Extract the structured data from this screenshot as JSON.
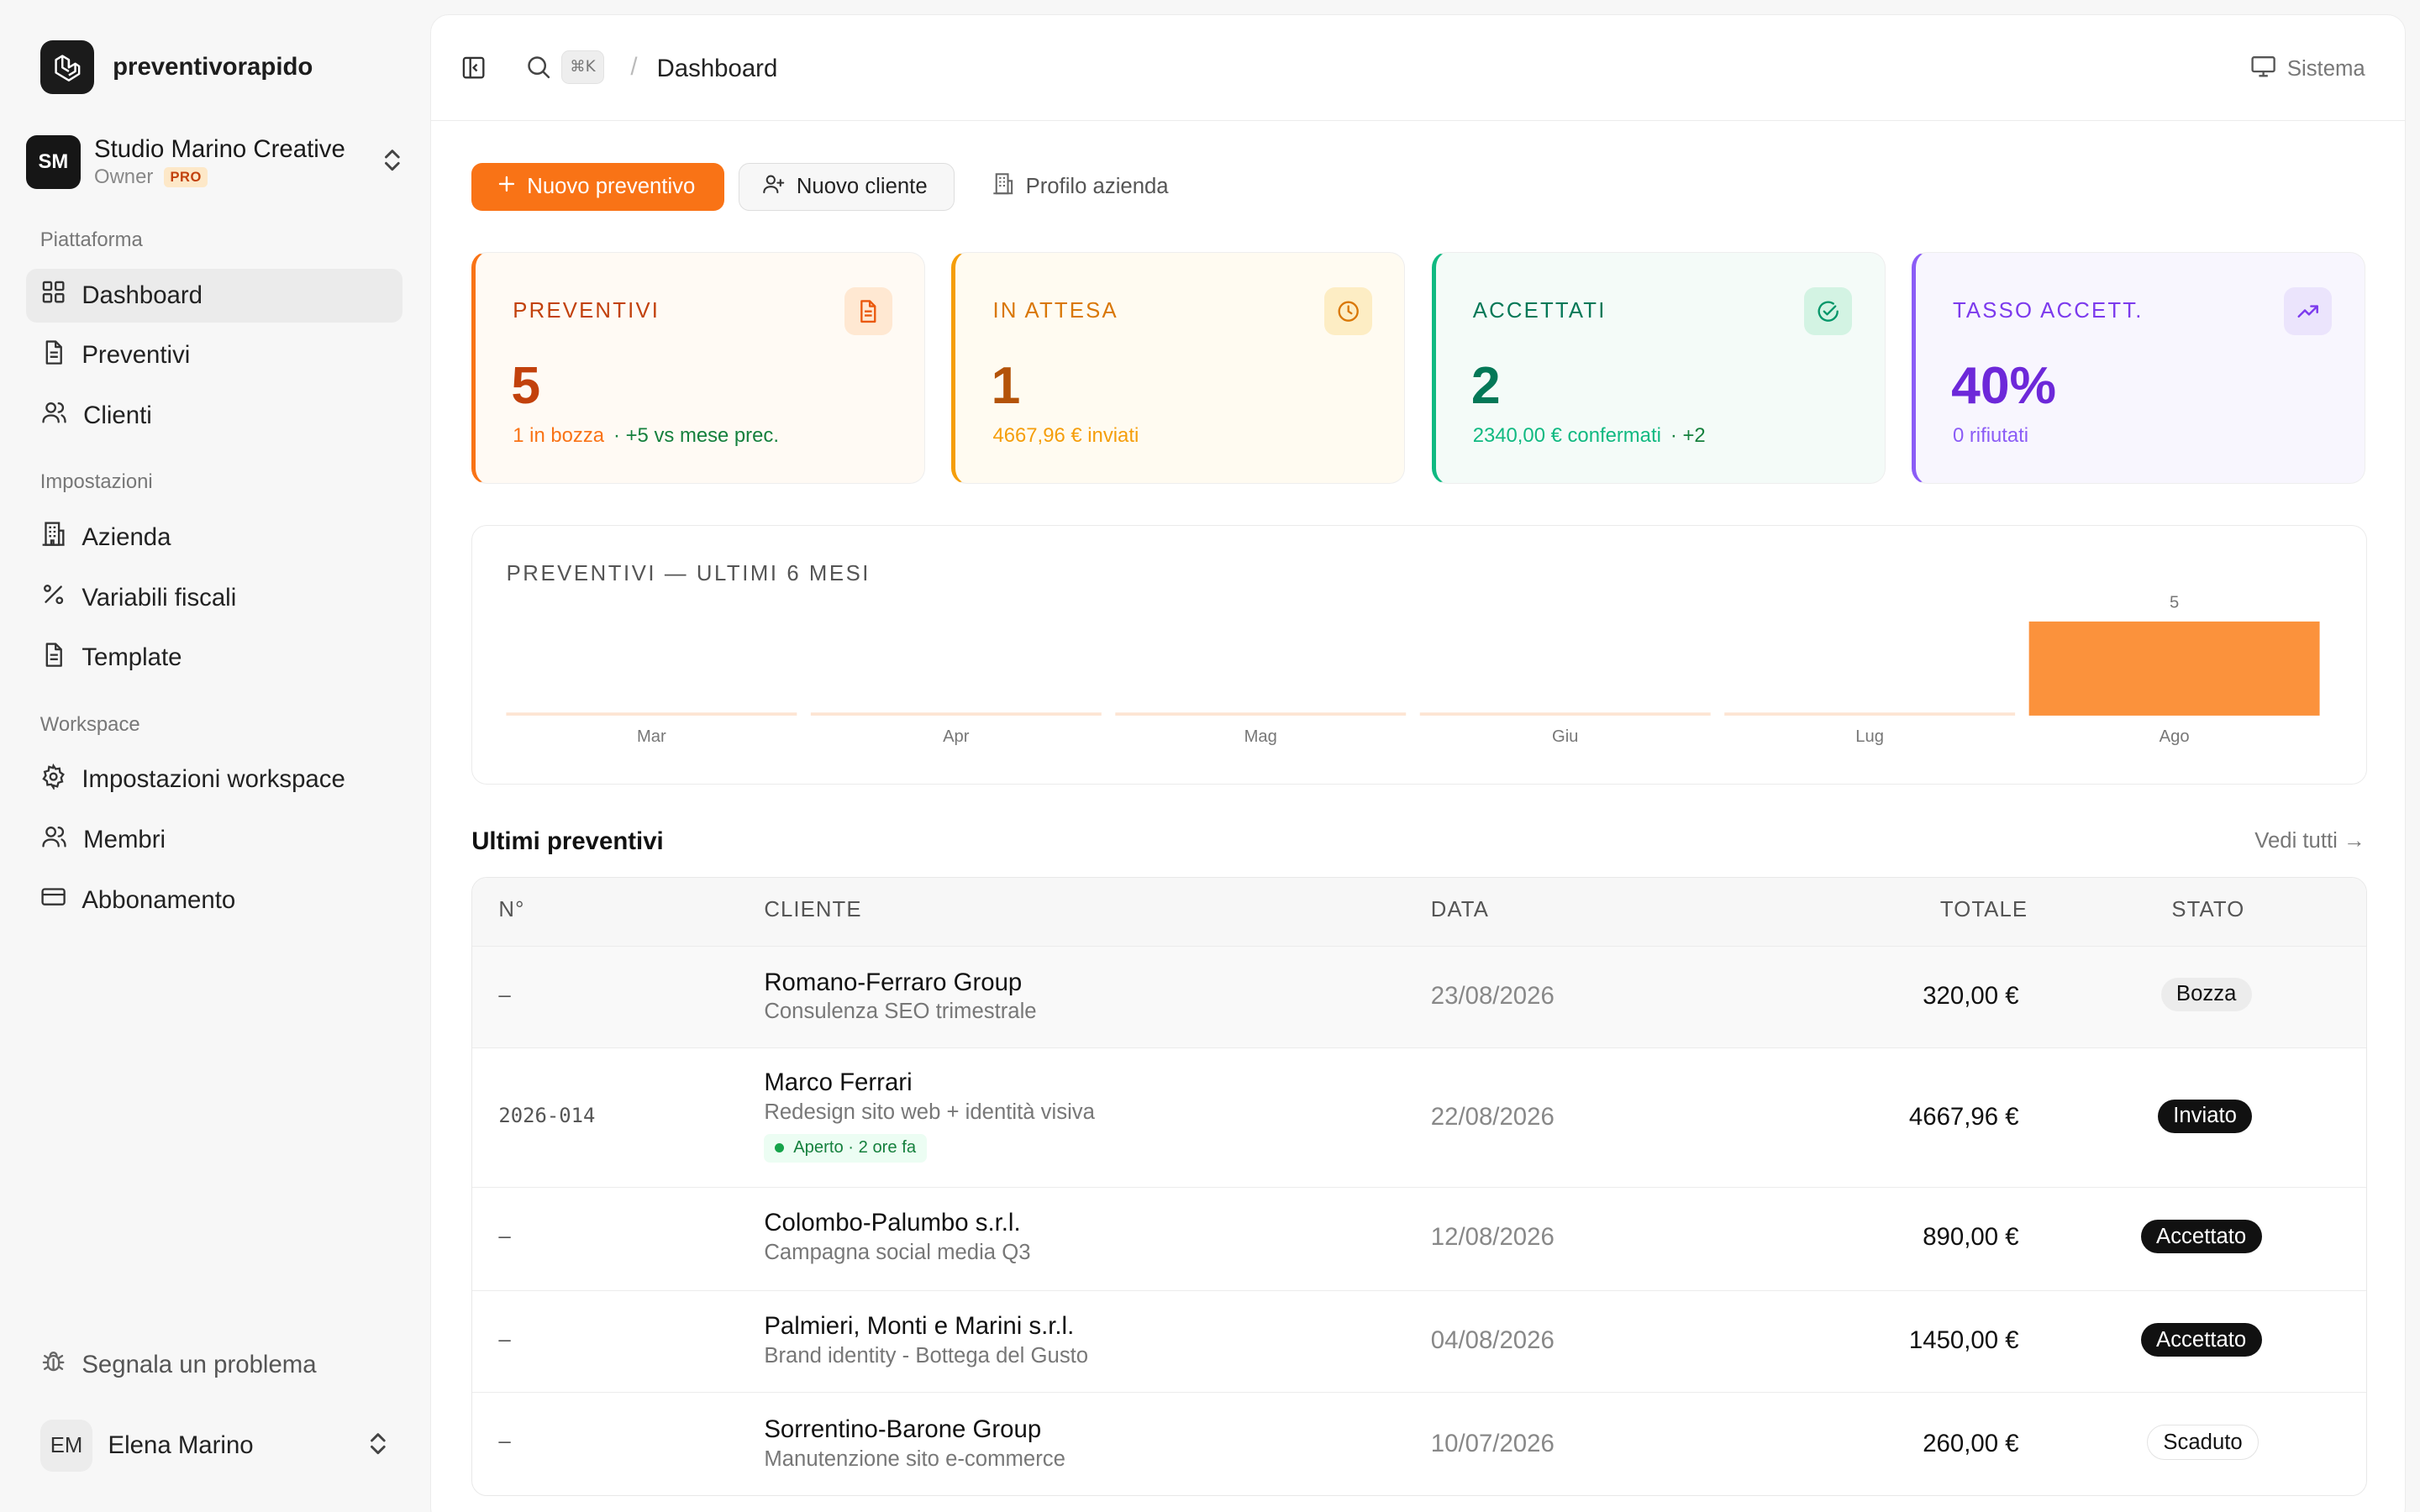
{
  "brand": {
    "name": "preventivorapido"
  },
  "org": {
    "initials": "SM",
    "name": "Studio Marino Creative",
    "role": "Owner",
    "plan": "PRO"
  },
  "sidebar": {
    "sections": [
      "Piattaforma",
      "Impostazioni",
      "Workspace"
    ],
    "items": [
      {
        "label": "Dashboard",
        "icon": "grid-icon"
      },
      {
        "label": "Preventivi",
        "icon": "document-icon"
      },
      {
        "label": "Clienti",
        "icon": "users-icon"
      },
      {
        "label": "Azienda",
        "icon": "building-icon"
      },
      {
        "label": "Variabili fiscali",
        "icon": "percent-icon"
      },
      {
        "label": "Template",
        "icon": "document-icon"
      },
      {
        "label": "Impostazioni workspace",
        "icon": "gear-icon"
      },
      {
        "label": "Membri",
        "icon": "users-icon"
      },
      {
        "label": "Abbonamento",
        "icon": "credit-card-icon"
      }
    ],
    "report": "Segnala un problema"
  },
  "user": {
    "initials": "EM",
    "name": "Elena Marino"
  },
  "topbar": {
    "kbd": "⌘K",
    "sep": "/",
    "crumb": "Dashboard",
    "theme": "Sistema"
  },
  "actions": {
    "new_quote": "Nuovo preventivo",
    "new_client": "Nuovo cliente",
    "company": "Profilo azienda"
  },
  "stats": [
    {
      "label": "PREVENTIVI",
      "value": "5",
      "sub": "1 in bozza",
      "extra": "· +5 vs mese prec.",
      "accent": "#f97316",
      "icon": "document-icon"
    },
    {
      "label": "IN ATTESA",
      "value": "1",
      "sub": "4667,96 € inviati",
      "extra": "",
      "accent": "#f59e0b",
      "icon": "clock-icon"
    },
    {
      "label": "ACCETTATI",
      "value": "2",
      "sub": "2340,00 € confermati",
      "extra": "· +2",
      "accent": "#10b981",
      "icon": "check-circle-icon"
    },
    {
      "label": "TASSO ACCETT.",
      "value": "40%",
      "sub": "0 rifiutati",
      "extra": "",
      "accent": "#8b5cf6",
      "icon": "trending-up-icon"
    }
  ],
  "chart_data": {
    "type": "bar",
    "title": "PREVENTIVI — ULTIMI 6 MESI",
    "categories": [
      "Mar",
      "Apr",
      "Mag",
      "Giu",
      "Lug",
      "Ago"
    ],
    "values": [
      0,
      0,
      0,
      0,
      0,
      5
    ],
    "ylim": [
      0,
      5
    ],
    "grid": false,
    "color": "#fb923c"
  },
  "recent": {
    "title": "Ultimi preventivi",
    "see_all": "Vedi tutti →",
    "columns": [
      "N°",
      "CLIENTE",
      "DATA",
      "TOTALE",
      "STATO"
    ],
    "rows": [
      {
        "num": "–",
        "client": "Romano-Ferraro Group",
        "desc": "Consulenza SEO trimestrale",
        "date": "23/08/2026",
        "total": "320,00 €",
        "status": "Bozza",
        "chip": ""
      },
      {
        "num": "2026-014",
        "client": "Marco Ferrari",
        "desc": "Redesign sito web + identità visiva",
        "date": "22/08/2026",
        "total": "4667,96 €",
        "status": "Inviato",
        "chip": "Aperto · 2 ore fa"
      },
      {
        "num": "–",
        "client": "Colombo-Palumbo s.r.l.",
        "desc": "Campagna social media Q3",
        "date": "12/08/2026",
        "total": "890,00 €",
        "status": "Accettato",
        "chip": ""
      },
      {
        "num": "–",
        "client": "Palmieri, Monti e Marini s.r.l.",
        "desc": "Brand identity - Bottega del Gusto",
        "date": "04/08/2026",
        "total": "1450,00 €",
        "status": "Accettato",
        "chip": ""
      },
      {
        "num": "–",
        "client": "Sorrentino-Barone Group",
        "desc": "Manutenzione sito e-commerce",
        "date": "10/07/2026",
        "total": "260,00 €",
        "status": "Scaduto",
        "chip": ""
      }
    ]
  }
}
